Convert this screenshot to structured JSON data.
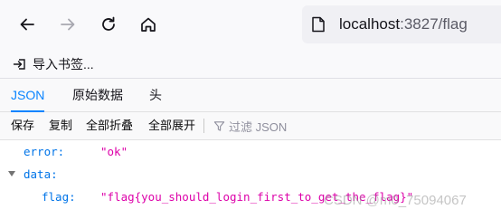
{
  "browser": {
    "url_host": "localhost",
    "url_rest": ":3827/flag",
    "bookmark_label": "导入书签..."
  },
  "viewer": {
    "tabs": [
      "JSON",
      "原始数据",
      "头"
    ],
    "actions": [
      "保存",
      "复制",
      "全部折叠",
      "全部展开"
    ],
    "filter_placeholder": "过滤 JSON"
  },
  "json": {
    "error_key": "error:",
    "error_value": "\"ok\"",
    "data_key": "data:",
    "flag_key": "flag:",
    "flag_value": "\"flag{you_should_login_first_to_get_the_flag}\""
  },
  "watermark": "CSDN @m0_75094067",
  "colors": {
    "accent": "#0a84ff",
    "key": "#0074e8",
    "string": "#dd00a9"
  }
}
